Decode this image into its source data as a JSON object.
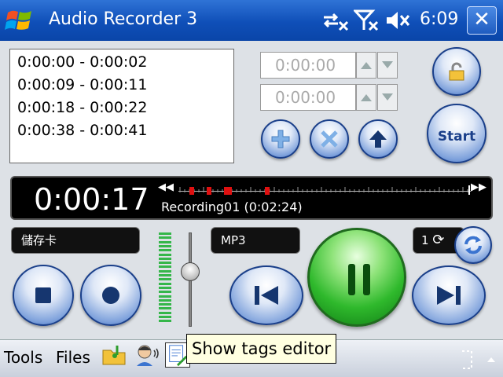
{
  "window": {
    "title": "Audio Recorder 3",
    "clock": "6:09",
    "close_label": "✕",
    "icons": [
      "windows-start-icon",
      "connectivity-icon",
      "signal-off-icon",
      "volume-muted-icon"
    ]
  },
  "intervals": {
    "items": [
      {
        "label": "0:00:00 - 0:00:02"
      },
      {
        "label": "0:00:09 - 0:00:11"
      },
      {
        "label": "0:00:18 - 0:00:22"
      },
      {
        "label": "0:00:38 - 0:00:41"
      }
    ]
  },
  "time_inputs": {
    "start_value": "0:00:00",
    "end_value": "0:00:00"
  },
  "buttons": {
    "start_label": "Start",
    "add": "plus-icon",
    "remove": "x-icon",
    "upload": "up-arrow-icon",
    "lock": "lock-icon"
  },
  "display": {
    "elapsed": "0:00:17",
    "filename": "Recording01 (0:02:24)",
    "rewind": "◀◀",
    "forward": "▶▶"
  },
  "controls": {
    "storage_label": "儲存卡",
    "format_label": "MP3",
    "repeat_count": "1"
  },
  "menubar": {
    "tools": "Tools",
    "files": "Files",
    "tooltip": "Show tags editor"
  },
  "colors": {
    "titlebar": "#1a5cc8",
    "pause_button": "#2fb92c",
    "marker": "#e01010"
  }
}
